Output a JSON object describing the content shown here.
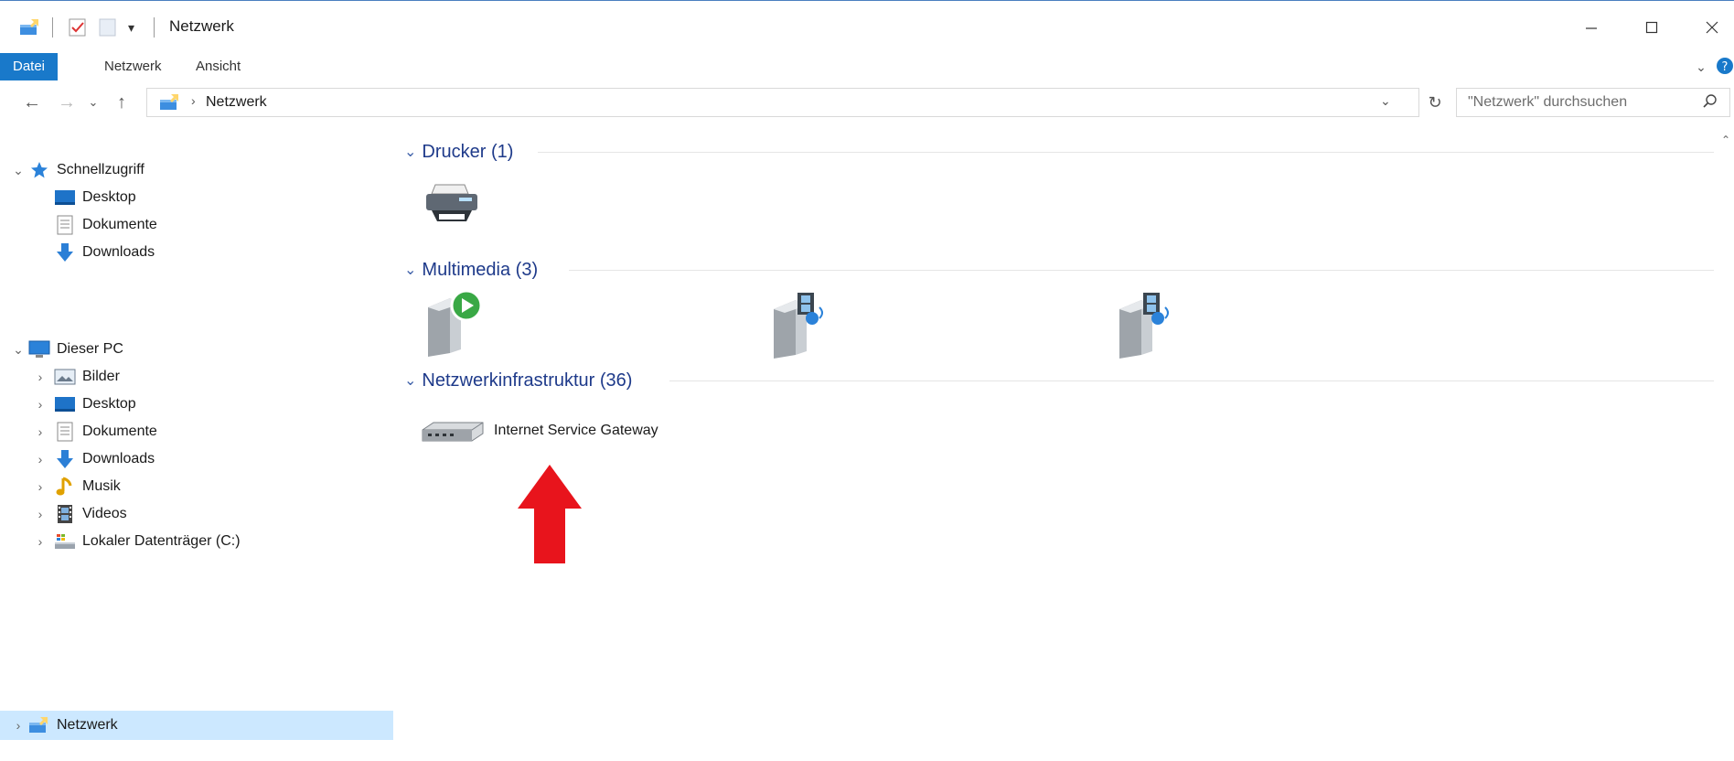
{
  "window": {
    "title": "Netzwerk",
    "minimize_icon": "minimize-icon",
    "maximize_icon": "maximize-icon",
    "close_icon": "close-icon"
  },
  "ribbon": {
    "tabs": [
      {
        "label": "Datei",
        "active": true
      },
      {
        "label": "Netzwerk",
        "active": false
      },
      {
        "label": "Ansicht",
        "active": false
      }
    ]
  },
  "address": {
    "path": "Netzwerk",
    "search_placeholder": "\"Netzwerk\" durchsuchen"
  },
  "sidebar": {
    "quick_access": {
      "label": "Schnellzugriff",
      "items": [
        {
          "label": "Desktop"
        },
        {
          "label": "Dokumente"
        },
        {
          "label": "Downloads"
        }
      ]
    },
    "this_pc": {
      "label": "Dieser PC",
      "items": [
        {
          "label": "Bilder"
        },
        {
          "label": "Desktop"
        },
        {
          "label": "Dokumente"
        },
        {
          "label": "Downloads"
        },
        {
          "label": "Musik"
        },
        {
          "label": "Videos"
        },
        {
          "label": "Lokaler Datenträger (C:)"
        }
      ]
    },
    "network": {
      "label": "Netzwerk"
    }
  },
  "content": {
    "groups": [
      {
        "label": "Drucker (1)"
      },
      {
        "label": "Multimedia (3)"
      },
      {
        "label": "Netzwerkinfrastruktur (36)"
      }
    ],
    "gateway_label": "Internet Service Gateway"
  },
  "colors": {
    "accent": "#1979ca",
    "group_header": "#1e3a8a",
    "selected_bg": "#cce8ff",
    "annotation_arrow": "#e8141c"
  }
}
